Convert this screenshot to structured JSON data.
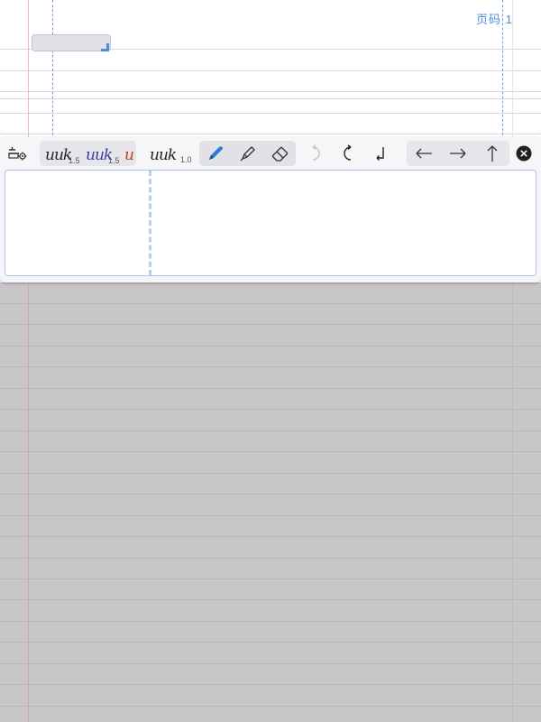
{
  "page": {
    "page_number_label": "页码 1"
  },
  "toolbar": {
    "settings_icon": "settings-icon",
    "pen_presets": [
      {
        "name": "black-pen-preset",
        "size": "1.5",
        "color": "#222222"
      },
      {
        "name": "blue-pen-preset",
        "size": "1.5",
        "color": "#3a3aa8"
      },
      {
        "name": "red-pen-preset",
        "size": "",
        "color": "#c0392b"
      }
    ],
    "current_pen": {
      "size": "1.0",
      "color": "#222222"
    },
    "tools": [
      "pen-icon",
      "highlighter-icon",
      "eraser-icon"
    ],
    "selected_tool": "pen",
    "edit_icons": [
      "undo-icon",
      "redo-icon",
      "return-icon"
    ],
    "arrow_icons": [
      "arrow-left-icon",
      "arrow-right-icon",
      "arrow-up-icon"
    ],
    "close_icon": "close-icon",
    "accent": "#2c7bd6"
  }
}
